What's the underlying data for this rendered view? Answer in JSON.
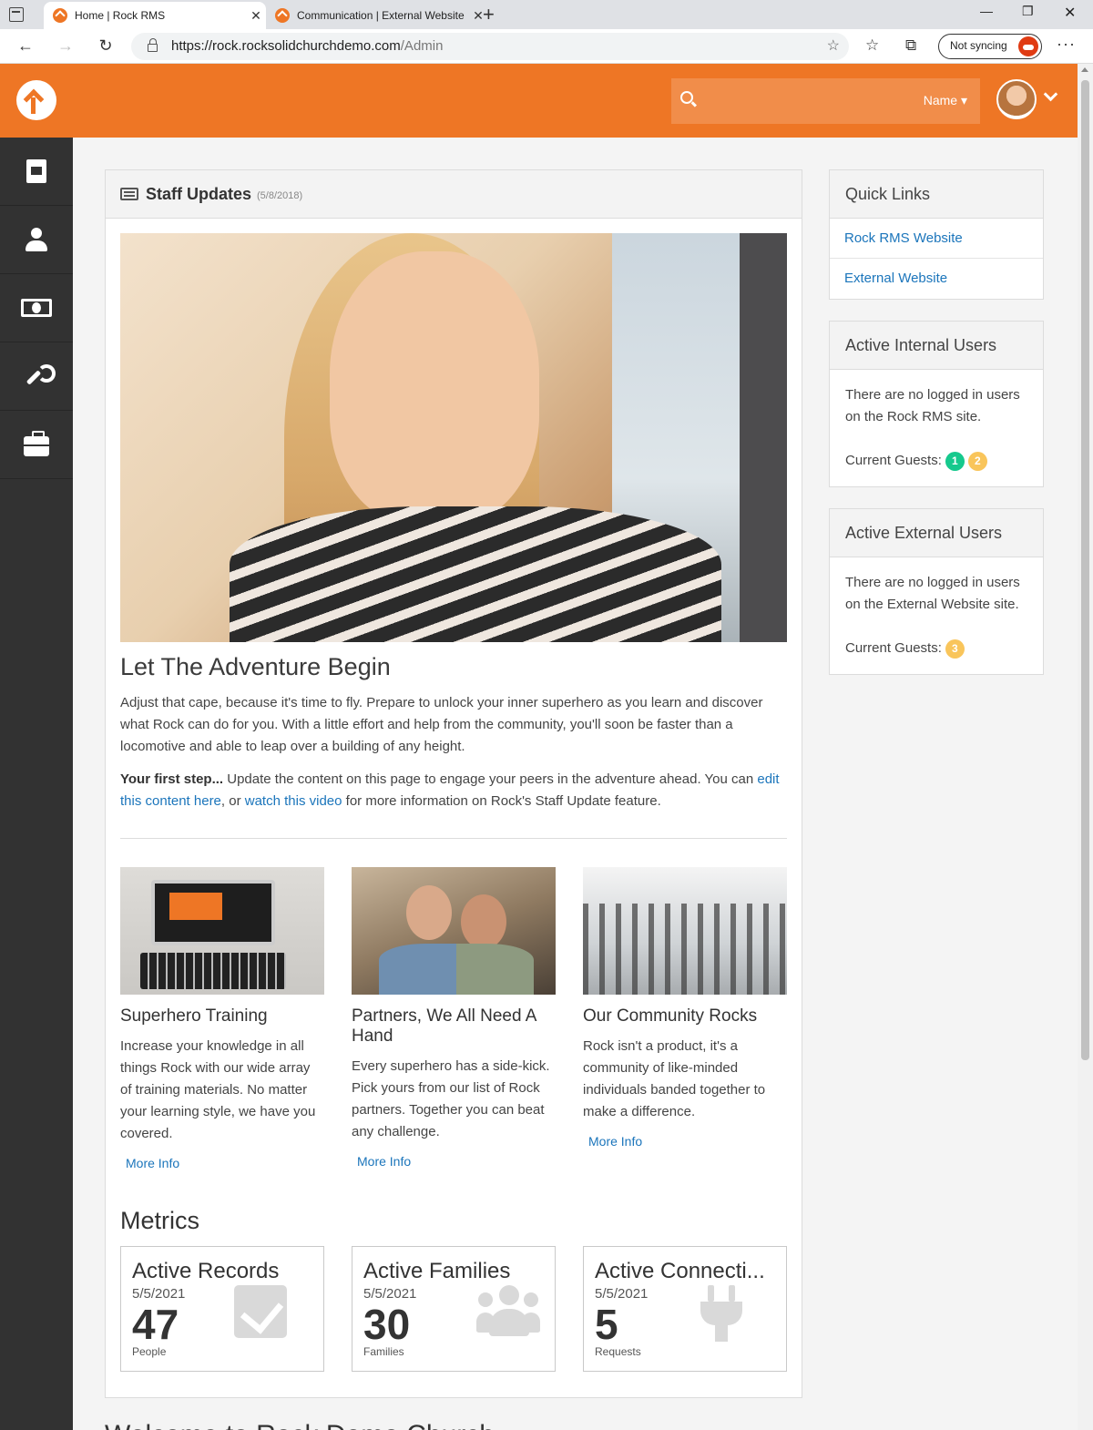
{
  "browser": {
    "tabs": [
      {
        "title": "Home | Rock RMS",
        "active": true
      },
      {
        "title": "Communication | External Website",
        "active": false
      }
    ],
    "url_host": "https://rock.rocksolidchurchdemo.com",
    "url_path": "/Admin",
    "sync_label": "Not syncing"
  },
  "header": {
    "search_placeholder": "",
    "search_filter": "Name ▾",
    "brand_color": "#ee7625"
  },
  "sidebar": {
    "items": [
      {
        "icon": "book-icon"
      },
      {
        "icon": "person-icon"
      },
      {
        "icon": "money-icon"
      },
      {
        "icon": "wrench-icon"
      },
      {
        "icon": "briefcase-icon"
      }
    ]
  },
  "staff_updates": {
    "title": "Staff Updates",
    "date": "(5/8/2018)",
    "heading": "Let The Adventure Begin",
    "para1": "Adjust that cape, because it's time to fly. Prepare to unlock your inner superhero as you learn and discover what Rock can do for you. With a little effort and help from the community, you'll soon be faster than a locomotive and able to leap over a building of any height.",
    "para2_bold": "Your first step...",
    "para2_text1": " Update the content on this page to engage your peers in the adventure ahead. You can ",
    "para2_link1": "edit this content here",
    "para2_text2": ", or ",
    "para2_link2": "watch this video",
    "para2_text3": " for more information on Rock's Staff Update feature."
  },
  "cards": [
    {
      "title": "Superhero Training",
      "body": "Increase your knowledge in all things Rock with our wide array of training materials. No matter your learning style, we have you covered.",
      "link": "More Info"
    },
    {
      "title": "Partners, We All Need A Hand",
      "body": "Every superhero has a side-kick. Pick yours from our list of Rock partners. Together you can beat any challenge.",
      "link": "More Info"
    },
    {
      "title": "Our Community Rocks",
      "body": "Rock isn't a product, it's a community of like-minded individuals banded together to make a difference.",
      "link": "More Info"
    }
  ],
  "metrics": {
    "title": "Metrics",
    "items": [
      {
        "title": "Active Records",
        "date": "5/5/2021",
        "value": "47",
        "unit": "People",
        "icon": "check-square-icon"
      },
      {
        "title": "Active Families",
        "date": "5/5/2021",
        "value": "30",
        "unit": "Families",
        "icon": "users-icon"
      },
      {
        "title": "Active Connecti...",
        "date": "5/5/2021",
        "value": "5",
        "unit": "Requests",
        "icon": "plug-icon"
      }
    ]
  },
  "quick_links": {
    "title": "Quick Links",
    "links": [
      "Rock RMS Website",
      "External Website"
    ]
  },
  "internal_users": {
    "title": "Active Internal Users",
    "message": "There are no logged in users on the Rock RMS site.",
    "guests_label": "Current Guests:",
    "badges": [
      "1",
      "2"
    ]
  },
  "external_users": {
    "title": "Active External Users",
    "message": "There are no logged in users on the External Website site.",
    "guests_label": "Current Guests:",
    "badges": [
      "3"
    ]
  },
  "footer_cut_text": "Welcome to Rock Demo Church"
}
